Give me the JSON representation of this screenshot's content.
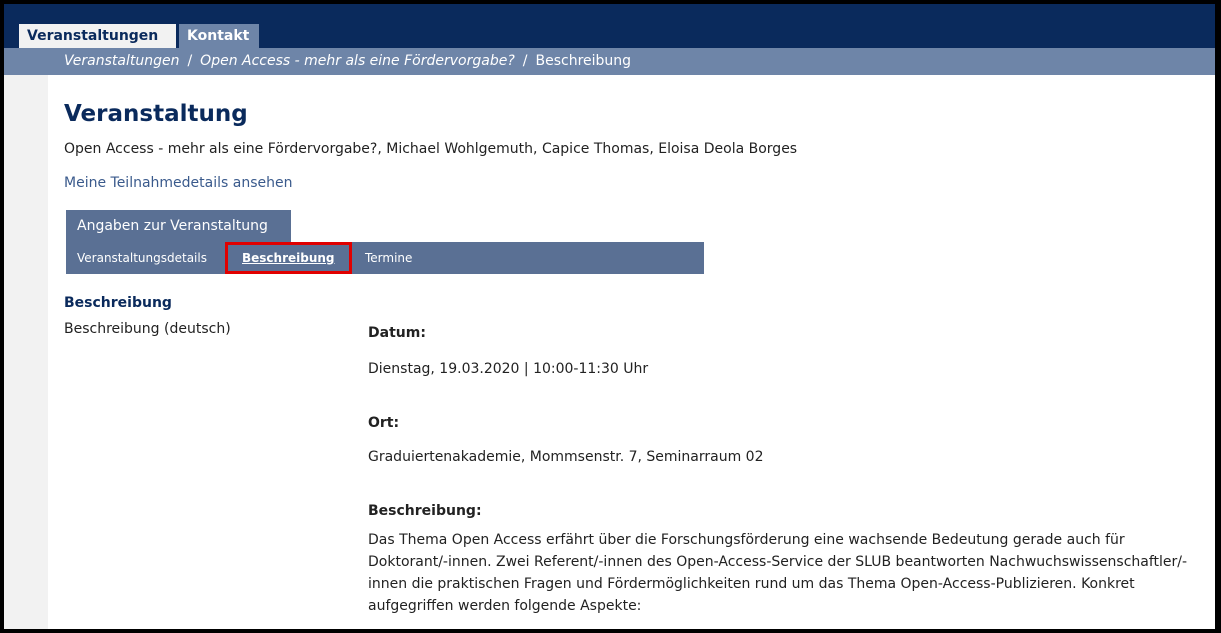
{
  "tabs": [
    {
      "label": "Veranstaltungen",
      "active": true
    },
    {
      "label": "Kontakt",
      "active": false
    }
  ],
  "breadcrumb": {
    "items": [
      "Veranstaltungen",
      "Open Access - mehr als eine Fördervorgabe?"
    ],
    "separator": "/",
    "current": "Beschreibung"
  },
  "page": {
    "title": "Veranstaltung",
    "subtitle": "Open Access - mehr als eine Fördervorgabe?, Michael Wohlgemuth, Capice Thomas, Eloisa Deola Borges",
    "details_link": "Meine Teilnahmedetails ansehen"
  },
  "section_tab": "Angaben zur Veranstaltung",
  "subnav": {
    "items": [
      "Veranstaltungsdetails",
      "Beschreibung",
      "Termine"
    ],
    "active": "Beschreibung"
  },
  "description_section": {
    "heading": "Beschreibung",
    "label": "Beschreibung (deutsch)",
    "date_label": "Datum:",
    "date_value": "Dienstag, 19.03.2020 | 10:00-11:30 Uhr",
    "place_label": "Ort:",
    "place_value": "Graduiertenakademie, Mommsenstr. 7, Seminarraum 02",
    "desc_label": "Beschreibung:",
    "desc_text": "Das Thema Open Access erfährt über die Forschungsförderung eine wachsende Bedeutung gerade auch für Doktorant/-innen. Zwei Referent/-innen des Open-Access-Service der SLUB beantworten Nachwuchswissenschaftler/-innen die praktischen Fragen und Fördermöglichkeiten rund um das Thema Open-Access-Publizieren. Konkret aufgegriffen werden folgende Aspekte:"
  },
  "colors": {
    "navy": "#0a2a5c",
    "bar_blue": "#6e85a8",
    "subnav_blue": "#5a7094",
    "link_blue": "#3a5a8c",
    "highlight_red": "#e00000"
  }
}
